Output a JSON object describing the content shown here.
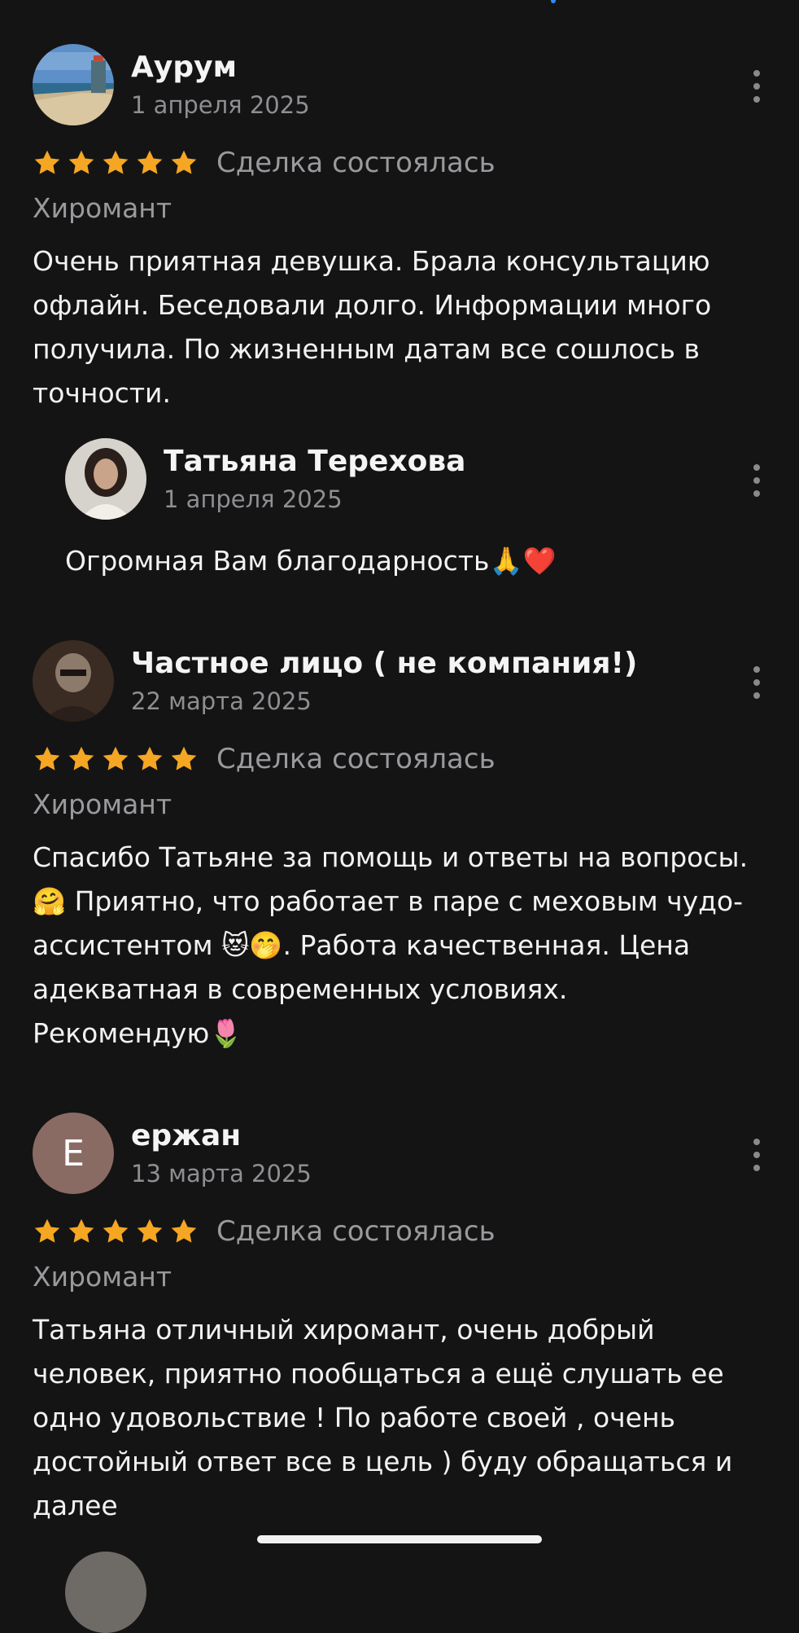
{
  "reviews": [
    {
      "author": "Аурум",
      "date": "1 апреля 2025",
      "rating": 5,
      "status": "Сделка состоялась",
      "category": "Хиромант",
      "text_lines": [
        "Очень  приятная  девушка. Брала консультацию",
        "офлайн. Беседовали долго. Информации много",
        "получила. По жизненным датам все сошлось в",
        "точности."
      ],
      "reply": {
        "author": "Татьяна Терехова",
        "date": "1 апреля 2025",
        "text": "Огромная Вам благодарность🙏❤️"
      }
    },
    {
      "author": "Частное лицо ( не компания!)",
      "date": "22 марта 2025",
      "rating": 5,
      "status": "Сделка состоялась",
      "category": "Хиромант",
      "text_lines": [
        "Спасибо Татьяне за помощь и ответы на вопросы.",
        "🤗 Приятно, что работает в паре с меховым чудо-",
        "ассистентом 😻🤭. Работа качественная. Цена",
        "адекватная в современных условиях.",
        "Рекомендую🌷"
      ]
    },
    {
      "author": "ержан",
      "avatar_letter": "Е",
      "date": "13 марта 2025",
      "rating": 5,
      "status": "Сделка состоялась",
      "category": "Хиромант",
      "text_lines": [
        "Татьяна отличный хиромант, очень добрый",
        "человек, приятно пообщаться а ещё слушать ее",
        "одно удовольствие ! По работе  своей , очень",
        "достойный ответ все в цель ) буду обращаться и",
        "далее"
      ]
    }
  ],
  "colors": {
    "background": "#141414",
    "star": "#f5a623",
    "secondary_text": "#8e8e93",
    "primary_text": "#f2f2f2"
  }
}
